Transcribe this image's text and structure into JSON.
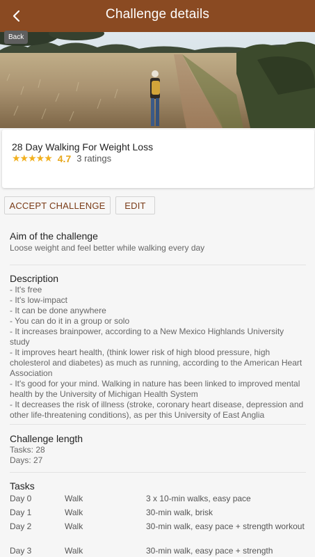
{
  "app_bar": {
    "title": "Challenge details",
    "back_tooltip": "Back",
    "color": "#8a4a22"
  },
  "challenge": {
    "title": "28 Day Walking For Weight Loss",
    "stars": "★★★★★",
    "rating": "4.7",
    "ratings_count": "3 ratings"
  },
  "actions": {
    "accept_label": "ACCEPT CHALLENGE",
    "edit_label": "EDIT"
  },
  "aim": {
    "title": "Aim of the challenge",
    "text": "Loose weight and feel better while walking every day"
  },
  "description": {
    "title": "Description",
    "lines": [
      "- It's free",
      "- It's low-impact",
      "- It can be done anywhere",
      "- You can do it in a group or solo",
      "- It increases brainpower, according to a New Mexico Highlands University study",
      "- It improves heart health, (think lower risk of high blood pressure, high cholesterol and diabetes) as much as running, according to the American Heart Association",
      "- It's good for your mind. Walking in nature has been linked to improved mental health by the University of Michigan Health System",
      "- It decreases the risk of illness (stroke, coronary heart disease, depression and other life-threatening conditions), as per this University of East Anglia"
    ]
  },
  "length": {
    "title": "Challenge length",
    "tasks": "Tasks: 28",
    "days": "Days: 27"
  },
  "tasks": {
    "title": "Tasks",
    "rows": [
      {
        "day": "Day 0",
        "activity": "Walk",
        "desc": "3 x 10-min walks, easy pace"
      },
      {
        "day": "Day 1",
        "activity": "Walk",
        "desc": "30-min walk, brisk"
      },
      {
        "day": "Day 2",
        "activity": "Walk",
        "desc": "30-min walk, easy pace + strength workout"
      },
      {
        "day": "Day 3",
        "activity": "Walk",
        "desc": "30-min walk, easy pace + strength"
      }
    ]
  }
}
